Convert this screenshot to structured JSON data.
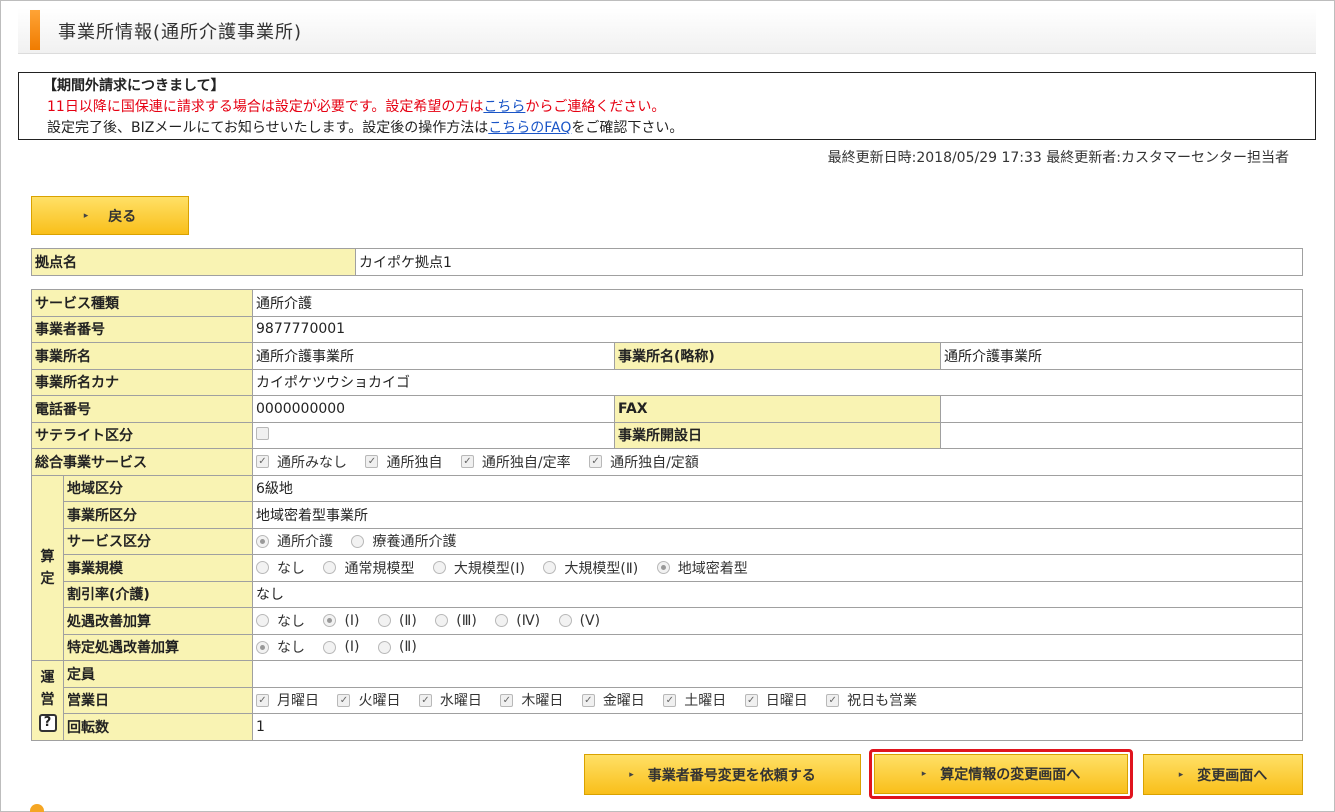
{
  "header": {
    "title": "事業所情報(通所介護事業所)"
  },
  "notice": {
    "title": "【期間外請求につきまして】",
    "line1_pre": "11日以降に国保連に請求する場合は設定が必要です。設定希望の方は",
    "line1_link": "こちら",
    "line1_post": "からご連絡ください。",
    "line2_pre": "設定完了後、BIZメールにてお知らせいたします。設定後の操作方法は",
    "line2_link": "こちらのFAQ",
    "line2_post": "をご確認下さい。"
  },
  "update_info": "最終更新日時:2018/05/29 17:33 最終更新者:カスタマーセンター担当者",
  "buttons": {
    "back": "戻る",
    "request_change": "事業者番号変更を依頼する",
    "calc_change": "算定情報の変更画面へ",
    "change": "変更画面へ"
  },
  "base": {
    "label": "拠点名",
    "value": "カイポケ拠点1"
  },
  "fields": {
    "service_type": {
      "label": "サービス種類",
      "value": "通所介護"
    },
    "operator_no": {
      "label": "事業者番号",
      "value": "9877770001"
    },
    "office_name": {
      "label": "事業所名",
      "value": "通所介護事業所"
    },
    "office_short": {
      "label": "事業所名(略称)",
      "value": "通所介護事業所"
    },
    "office_kana": {
      "label": "事業所名カナ",
      "value": "カイポケツウショカイゴ"
    },
    "phone": {
      "label": "電話番号",
      "value": "0000000000"
    },
    "fax": {
      "label": "FAX",
      "value": ""
    },
    "satellite": {
      "label": "サテライト区分"
    },
    "open_date": {
      "label": "事業所開設日",
      "value": ""
    },
    "sogo": {
      "label": "総合事業サービス",
      "options": [
        "通所みなし",
        "通所独自",
        "通所独自/定率",
        "通所独自/定額"
      ]
    },
    "calc_group": {
      "label1": "算",
      "label2": "定"
    },
    "area": {
      "label": "地域区分",
      "value": "6級地"
    },
    "office_class": {
      "label": "事業所区分",
      "value": "地域密着型事業所"
    },
    "service_class": {
      "label": "サービス区分",
      "options": [
        "通所介護",
        "療養通所介護"
      ]
    },
    "scale": {
      "label": "事業規模",
      "options": [
        "なし",
        "通常規模型",
        "大規模型(Ⅰ)",
        "大規模型(Ⅱ)",
        "地域密着型"
      ]
    },
    "discount": {
      "label": "割引率(介護)",
      "value": "なし"
    },
    "treatment": {
      "label": "処遇改善加算",
      "options": [
        "なし",
        "(Ⅰ)",
        "(Ⅱ)",
        "(Ⅲ)",
        "(Ⅳ)",
        "(Ⅴ)"
      ]
    },
    "special_treatment": {
      "label": "特定処遇改善加算",
      "options": [
        "なし",
        "(Ⅰ)",
        "(Ⅱ)"
      ]
    },
    "ops_group": {
      "label1": "運",
      "label2": "営",
      "help": "?"
    },
    "capacity": {
      "label": "定員",
      "value": ""
    },
    "business_days": {
      "label": "営業日",
      "options": [
        "月曜日",
        "火曜日",
        "水曜日",
        "木曜日",
        "金曜日",
        "土曜日",
        "日曜日",
        "祝日も営業"
      ]
    },
    "rotation": {
      "label": "回転数",
      "value": "1"
    }
  }
}
